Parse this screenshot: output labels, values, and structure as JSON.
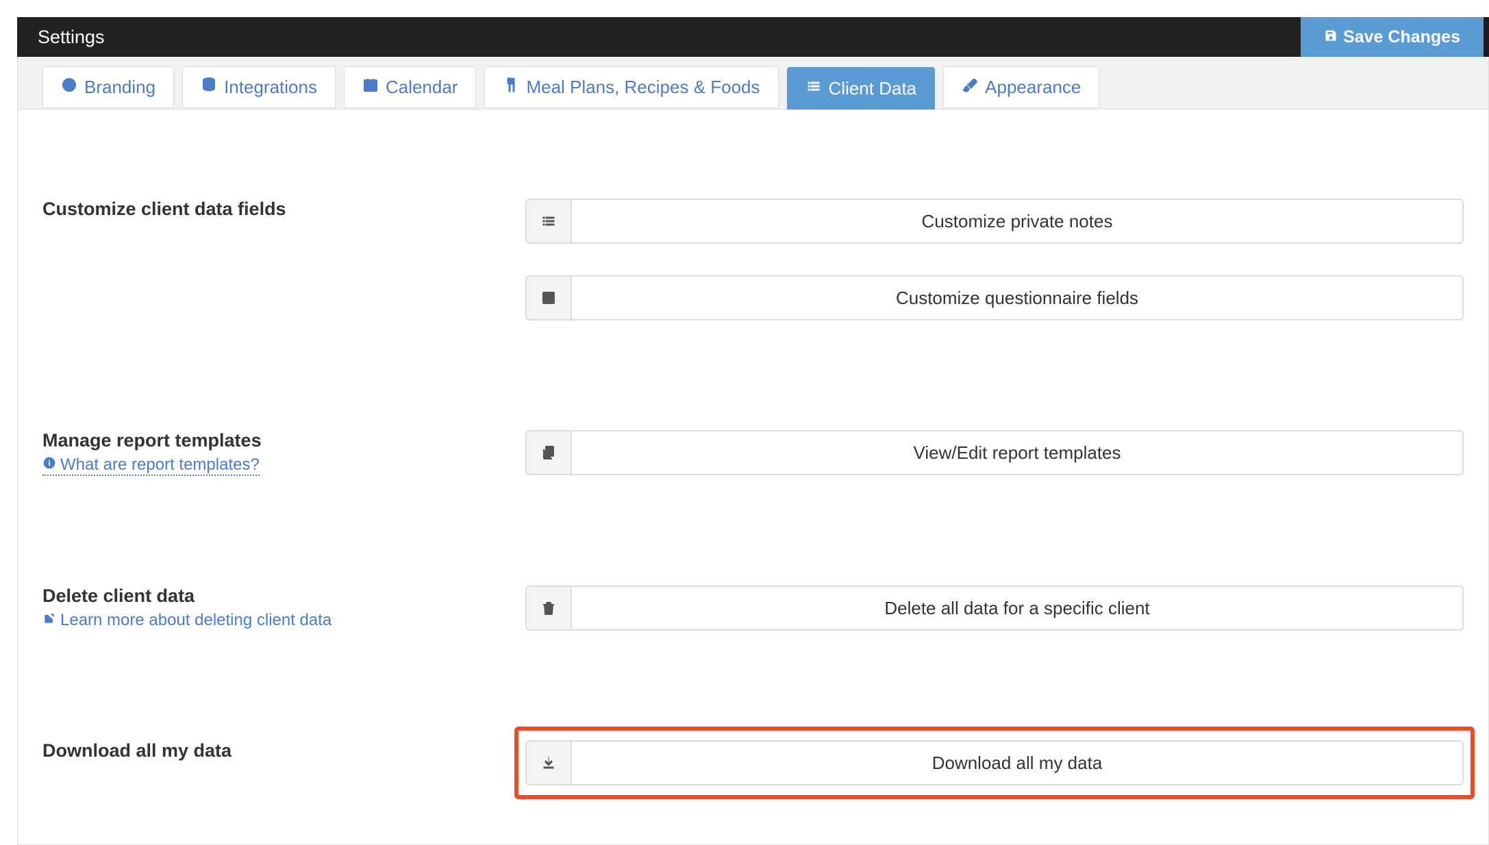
{
  "header": {
    "title": "Settings",
    "save_label": "Save Changes"
  },
  "tabs": {
    "branding": "Branding",
    "integrations": "Integrations",
    "calendar": "Calendar",
    "meal": "Meal Plans, Recipes & Foods",
    "client_data": "Client Data",
    "appearance": "Appearance"
  },
  "sections": {
    "customize": {
      "label": "Customize client data fields",
      "btn_notes": "Customize private notes",
      "btn_questionnaire": "Customize questionnaire fields"
    },
    "reports": {
      "label": "Manage report templates",
      "help": "What are report templates?",
      "btn": "View/Edit report templates"
    },
    "delete": {
      "label": "Delete client data",
      "help": "Learn more about deleting client data",
      "btn": "Delete all data for a specific client"
    },
    "download": {
      "label": "Download all my data",
      "btn": "Download all my data"
    }
  }
}
